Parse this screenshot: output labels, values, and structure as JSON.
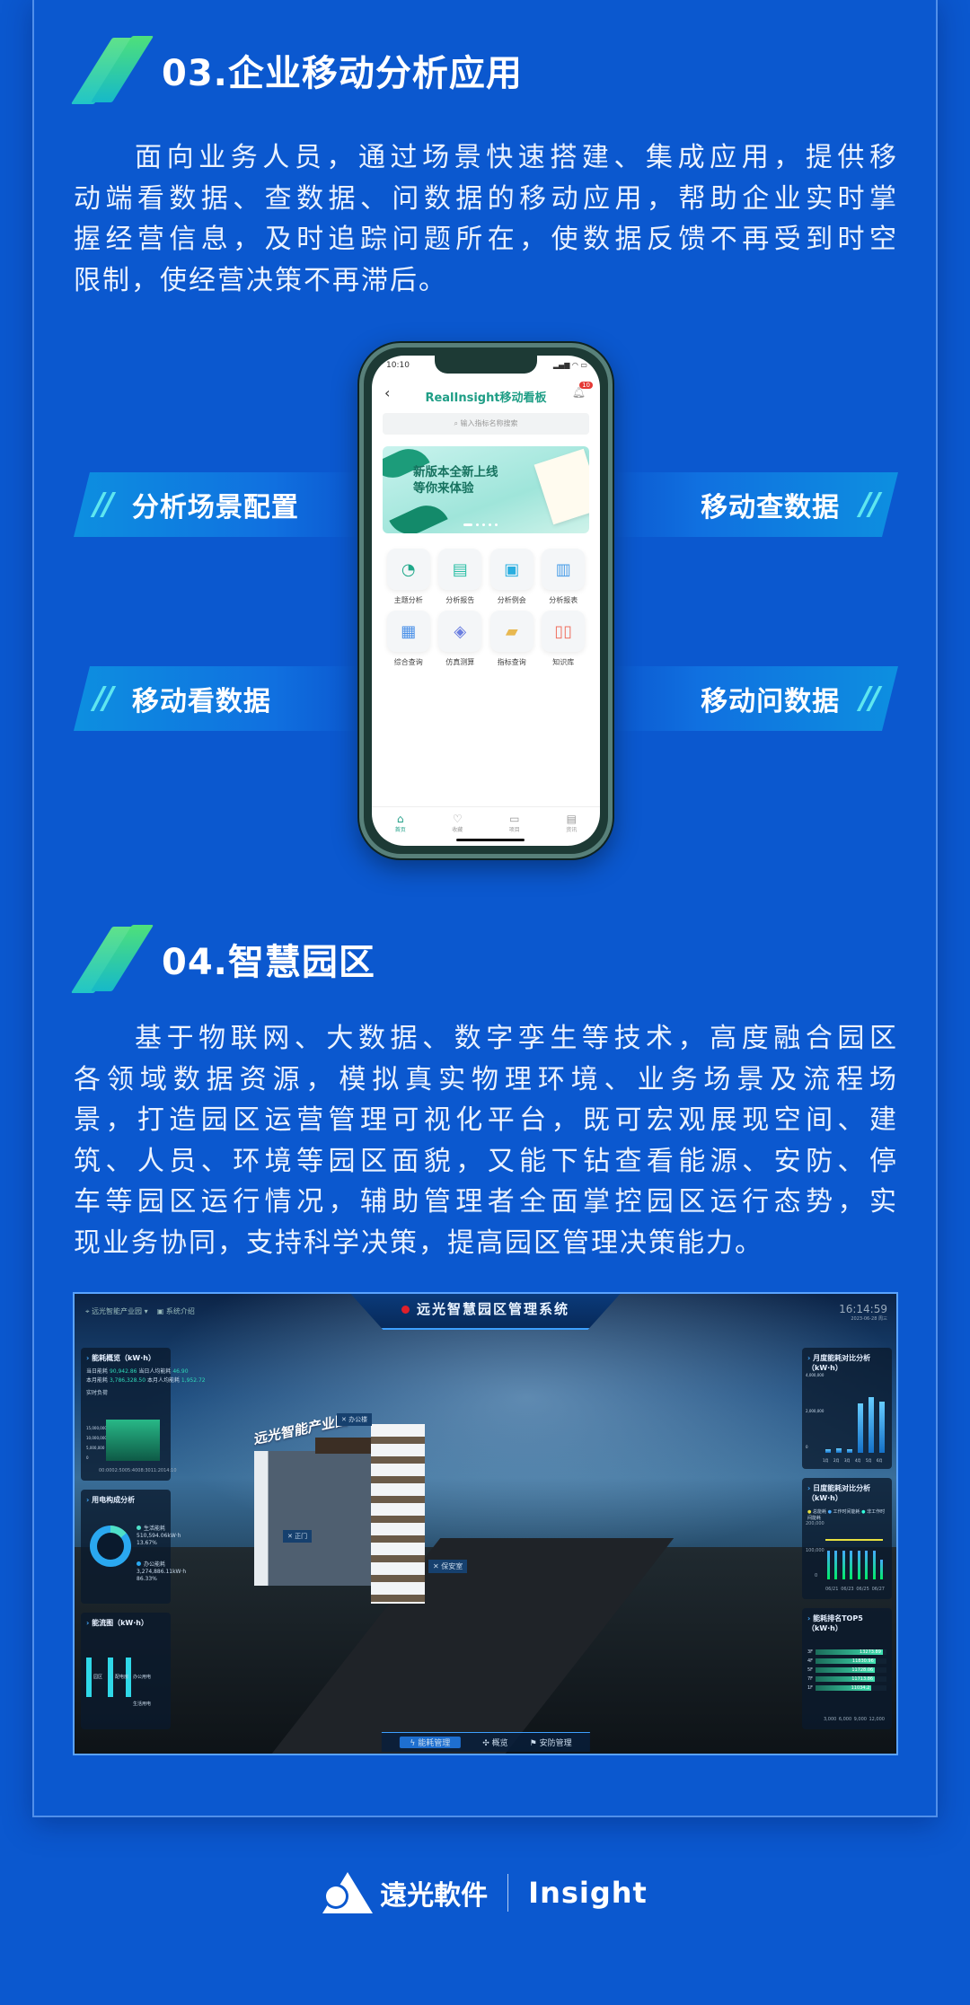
{
  "section3": {
    "title": "03.企业移动分析应用",
    "paragraph_lines": [
      "面向业务人员，通过场景快速搭建、集成应用，提供移",
      "动端看数据、查数据、问数据的移动应用，帮助企业实时掌",
      "握经营信息，及时追踪问题所在，使数据反馈不再受到时空",
      "限制，使经营决策不再滞后。"
    ],
    "tags": [
      "分析场景配置",
      "移动查数据",
      "移动看数据",
      "移动问数据"
    ],
    "tag_mark": "//"
  },
  "phone": {
    "time": "10:10",
    "status_icons": "▂▄▆ ◠ ▭",
    "title": "RealInsight移动看板",
    "back": "‹",
    "notification_count": "10",
    "search_placeholder": "输入指标名称搜索",
    "banner_lines": [
      "新版本全新上线",
      "等你来体验"
    ],
    "grid": [
      {
        "label": "主题分析",
        "icon": "pie-chart",
        "glyph": "◔",
        "color": "#20a88a"
      },
      {
        "label": "分析报告",
        "icon": "clipboard",
        "glyph": "▤",
        "color": "#2bbfa6"
      },
      {
        "label": "分析例会",
        "icon": "meeting",
        "glyph": "▣",
        "color": "#2aaee0"
      },
      {
        "label": "分析报表",
        "icon": "bar-chart",
        "glyph": "▥",
        "color": "#4a9de8"
      },
      {
        "label": "综合查询",
        "icon": "grid-search",
        "glyph": "▦",
        "color": "#4a90e8"
      },
      {
        "label": "仿真测算",
        "icon": "cube",
        "glyph": "◈",
        "color": "#6a7ee0"
      },
      {
        "label": "指标查询",
        "icon": "folder-search",
        "glyph": "▰",
        "color": "#e8b850"
      },
      {
        "label": "知识库",
        "icon": "book",
        "glyph": "▯▯",
        "color": "#f07060"
      }
    ],
    "tabbar": [
      {
        "label": "首页",
        "glyph": "⌂"
      },
      {
        "label": "收藏",
        "glyph": "♡"
      },
      {
        "label": "项目",
        "glyph": "▭"
      },
      {
        "label": "资讯",
        "glyph": "▤"
      }
    ]
  },
  "section4": {
    "title": "04.智慧园区",
    "paragraph_lines": [
      "基于物联网、大数据、数字孪生等技术，高度融合园区",
      "各领域数据资源，模拟真实物理环境、业务场景及流程场",
      "景，打造园区运营管理可视化平台，既可宏观展现空间、建",
      "筑、人员、环境等园区面貌，又能下钻查看能源、安防、停",
      "车等园区运行情况，辅助管理者全面掌控园区运行态势，实",
      "现业务协同，支持科学决策，提高园区管理决策能力。"
    ]
  },
  "dashboard": {
    "title": "远光智慧园区管理系统",
    "location": "远光智能产业园",
    "system_intro": "系统介绍",
    "time": "16:14:59",
    "date": "2023-06-28 周三",
    "park_sign": "远光智能产业园",
    "labels": {
      "office": "办公楼",
      "gate": "正门",
      "security": "保安室"
    },
    "energy_overview": {
      "title": "能耗概览（kW·h）",
      "today_label": "当日能耗",
      "today": "90,942.86",
      "today_pp_label": "当日人均能耗",
      "today_pp": "46.90",
      "month_label": "本月能耗",
      "month": "3,786,328.50",
      "month_pp_label": "本月人均能耗",
      "month_pp": "1,952.72",
      "realtime_label": "实时负荷",
      "y_ticks": [
        "15,000,000",
        "10,000,000",
        "5,000,000",
        "0"
      ],
      "x_ticks": [
        "00:00",
        "02:50",
        "05:40",
        "08:30",
        "11:20",
        "14:10"
      ]
    },
    "composition": {
      "title": "用电构成分析",
      "items": [
        {
          "name": "生活能耗",
          "value": "510,594.06kW·h",
          "pct": "13.67%",
          "color": "#4fe0c8"
        },
        {
          "name": "办公能耗",
          "value": "3,274,886.11kW·h",
          "pct": "86.33%",
          "color": "#2aa8f0"
        }
      ]
    },
    "flow": {
      "title": "能流图（kW·h）",
      "nodes": [
        "园区",
        "配电房",
        "办公用电",
        "生活用电"
      ]
    },
    "monthly": {
      "title": "月度能耗对比分析（kW·h）",
      "y_ticks": [
        "4,000,000",
        "2,000,000",
        "0"
      ],
      "months": [
        "1月",
        "2月",
        "3月",
        "4月",
        "5月",
        "6月"
      ],
      "values": [
        200000,
        250000,
        200000,
        2600000,
        2900000,
        2700000
      ]
    },
    "daily": {
      "title": "日度能耗对比分析（kW·h）",
      "legend": [
        "总能耗",
        "工作时间能耗",
        "非工作时间能耗"
      ],
      "y_ticks": [
        "200,000",
        "100,000",
        "0"
      ],
      "x_ticks": [
        "06/21",
        "06/23",
        "06/25",
        "06/27"
      ]
    },
    "top5": {
      "title": "能耗排名TOP5（kW·h）",
      "items": [
        {
          "floor": "3F",
          "value": 13273.89
        },
        {
          "floor": "4F",
          "value": 11830.96
        },
        {
          "floor": "5F",
          "value": 11728.06
        },
        {
          "floor": "7F",
          "value": 11713.86
        },
        {
          "floor": "1F",
          "value": 11034.2
        }
      ],
      "x_ticks": [
        "3,000",
        "6,000",
        "9,000",
        "12,000"
      ],
      "max": 14000
    },
    "tabs": [
      "能耗管理",
      "概览",
      "安防管理"
    ]
  },
  "footer": {
    "brand_cn": "遠光軟件",
    "brand_en": "Insight"
  },
  "colors": {
    "background": "#0b58cf",
    "accent_green": "#1f9e86",
    "tag_cyan": "#5ee6f0"
  }
}
